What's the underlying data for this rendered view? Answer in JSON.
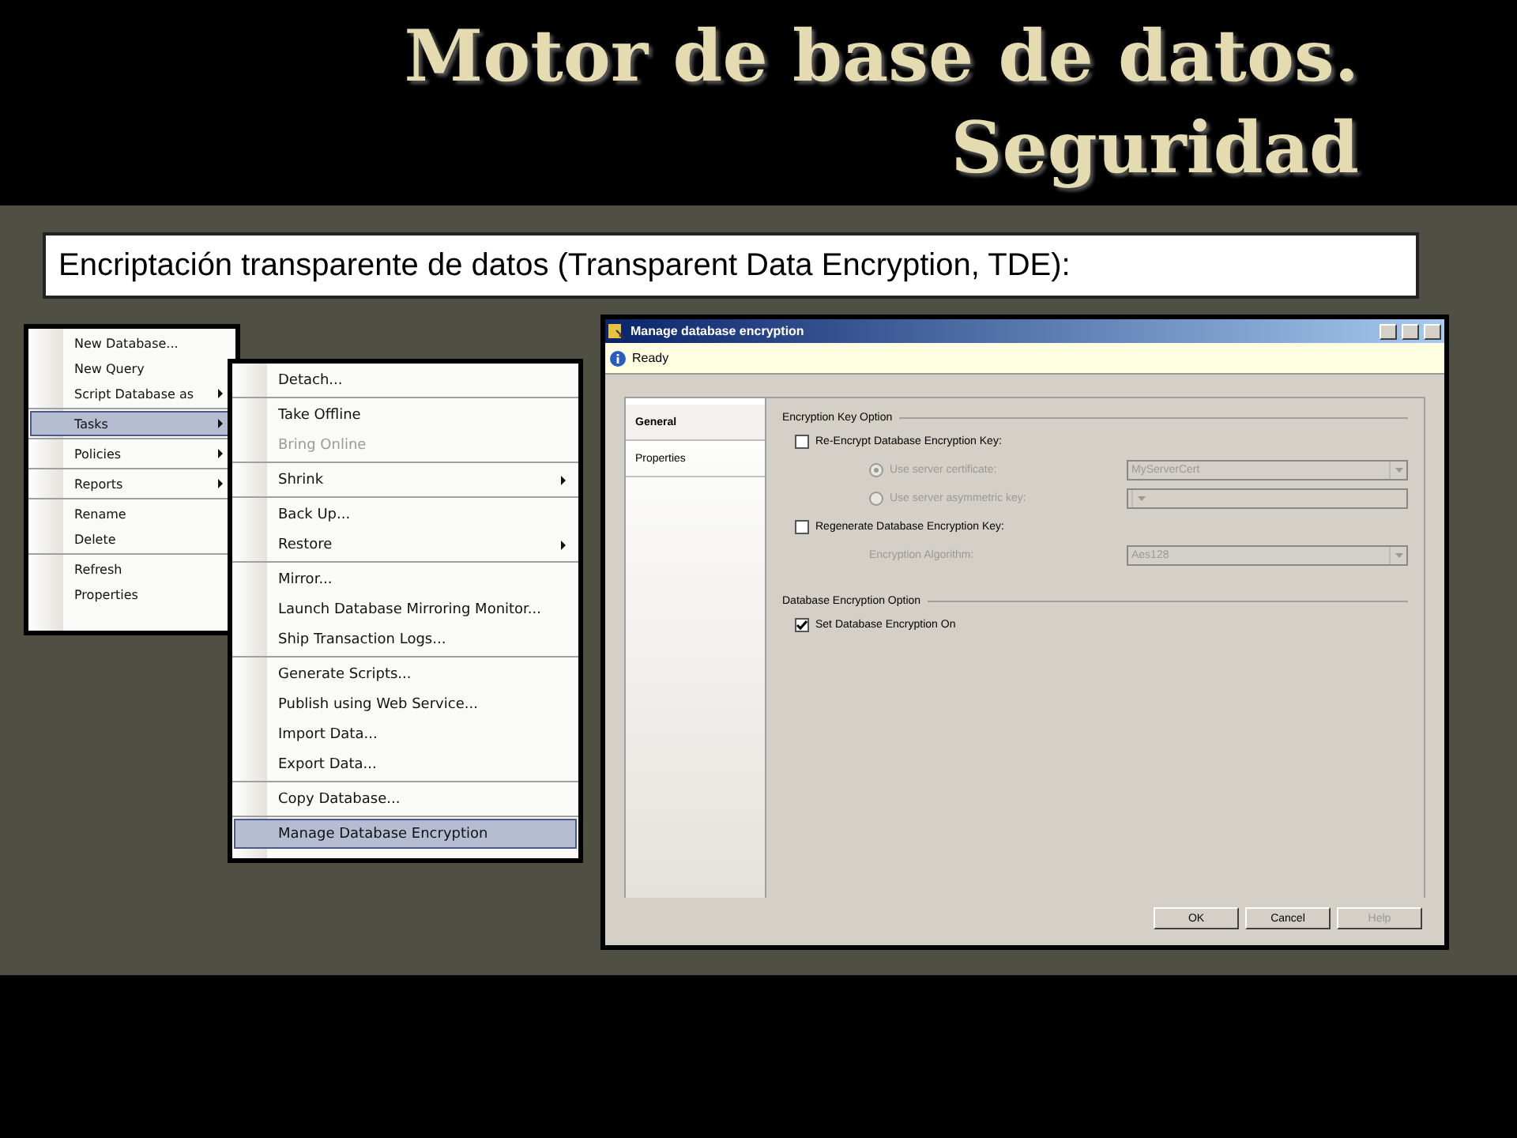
{
  "slide": {
    "title_lines": [
      "Motor de base de datos.",
      "Seguridad"
    ],
    "subtitle": "Encriptación transparente de datos (Transparent Data Encryption, TDE):"
  },
  "context_menu": {
    "groups": [
      [
        {
          "label": "New Database...",
          "selected": false,
          "submenu": false,
          "disabled": false
        },
        {
          "label": "New Query",
          "selected": false,
          "submenu": false,
          "disabled": false
        },
        {
          "label": "Script Database as",
          "selected": false,
          "submenu": true,
          "disabled": false
        }
      ],
      [
        {
          "label": "Tasks",
          "selected": true,
          "submenu": true,
          "disabled": false
        }
      ],
      [
        {
          "label": "Policies",
          "selected": false,
          "submenu": true,
          "disabled": false
        }
      ],
      [
        {
          "label": "Reports",
          "selected": false,
          "submenu": true,
          "disabled": false
        }
      ],
      [
        {
          "label": "Rename",
          "selected": false,
          "submenu": false,
          "disabled": false
        },
        {
          "label": "Delete",
          "selected": false,
          "submenu": false,
          "disabled": false
        }
      ],
      [
        {
          "label": "Refresh",
          "selected": false,
          "submenu": false,
          "disabled": false
        },
        {
          "label": "Properties",
          "selected": false,
          "submenu": false,
          "disabled": false
        }
      ]
    ]
  },
  "tasks_menu": {
    "groups": [
      [
        {
          "label": "Detach...",
          "selected": false,
          "submenu": false,
          "disabled": false
        }
      ],
      [
        {
          "label": "Take Offline",
          "selected": false,
          "submenu": false,
          "disabled": false
        },
        {
          "label": "Bring Online",
          "selected": false,
          "submenu": false,
          "disabled": true
        }
      ],
      [
        {
          "label": "Shrink",
          "selected": false,
          "submenu": true,
          "disabled": false
        }
      ],
      [
        {
          "label": "Back Up...",
          "selected": false,
          "submenu": false,
          "disabled": false
        },
        {
          "label": "Restore",
          "selected": false,
          "submenu": true,
          "disabled": false
        }
      ],
      [
        {
          "label": "Mirror...",
          "selected": false,
          "submenu": false,
          "disabled": false
        },
        {
          "label": "Launch Database Mirroring Monitor...",
          "selected": false,
          "submenu": false,
          "disabled": false
        },
        {
          "label": "Ship Transaction Logs...",
          "selected": false,
          "submenu": false,
          "disabled": false
        }
      ],
      [
        {
          "label": "Generate Scripts...",
          "selected": false,
          "submenu": false,
          "disabled": false
        },
        {
          "label": "Publish using Web Service...",
          "selected": false,
          "submenu": false,
          "disabled": false
        },
        {
          "label": "Import Data...",
          "selected": false,
          "submenu": false,
          "disabled": false
        },
        {
          "label": "Export Data...",
          "selected": false,
          "submenu": false,
          "disabled": false
        }
      ],
      [
        {
          "label": "Copy Database...",
          "selected": false,
          "submenu": false,
          "disabled": false
        }
      ],
      [
        {
          "label": "Manage Database Encryption",
          "selected": true,
          "submenu": false,
          "disabled": false
        }
      ]
    ]
  },
  "dialog": {
    "title": "Manage database encryption",
    "status": "Ready",
    "tabs": [
      {
        "label": "General",
        "selected": true
      },
      {
        "label": "Properties",
        "selected": false
      }
    ],
    "sections": [
      {
        "title": "Encryption Key Option",
        "rows": [
          {
            "kind": "checkbox",
            "label": "Re-Encrypt Database Encryption Key:",
            "checked": false,
            "disabled": false
          },
          {
            "kind": "radio",
            "label": "Use server certificate:",
            "selected": true,
            "disabled": true,
            "value": "MyServerCert"
          },
          {
            "kind": "radio",
            "label": "Use server asymmetric key:",
            "selected": false,
            "disabled": true
          },
          {
            "kind": "checkbox",
            "label": "Regenerate Database Encryption Key:",
            "checked": false,
            "disabled": false
          },
          {
            "kind": "field",
            "label": "Encryption Algorithm:",
            "disabled": true,
            "value": "Aes128"
          }
        ]
      },
      {
        "title": "Database Encryption Option",
        "rows": [
          {
            "kind": "checkbox",
            "label": "Set Database Encryption On",
            "checked": true,
            "disabled": false
          }
        ]
      }
    ],
    "buttons": [
      {
        "label": "OK",
        "disabled": false
      },
      {
        "label": "Cancel",
        "disabled": false
      },
      {
        "label": "Help",
        "disabled": true
      }
    ]
  }
}
